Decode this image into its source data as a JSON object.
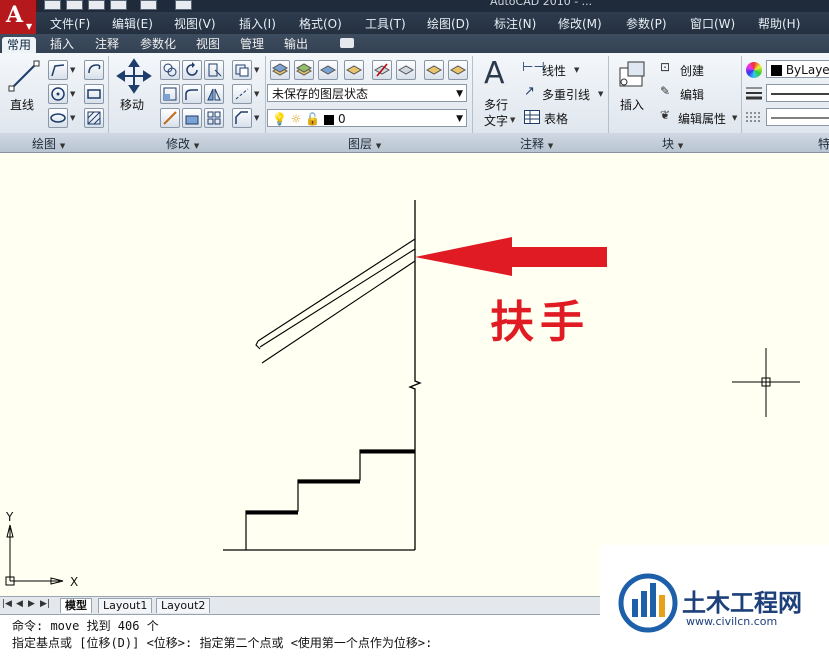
{
  "app": {
    "title_fragment": "AutoCAD 2010 - ..."
  },
  "menubar": [
    "文件(F)",
    "编辑(E)",
    "视图(V)",
    "插入(I)",
    "格式(O)",
    "工具(T)",
    "绘图(D)",
    "标注(N)",
    "修改(M)",
    "参数(P)",
    "窗口(W)",
    "帮助(H)"
  ],
  "tabs": [
    "常用",
    "插入",
    "注释",
    "参数化",
    "视图",
    "管理",
    "输出"
  ],
  "ribbon": {
    "draw": {
      "line": "直线",
      "panel": "绘图"
    },
    "modify": {
      "move": "移动",
      "panel": "修改"
    },
    "layers": {
      "state": "未保存的图层状态",
      "current": "0",
      "panel": "图层"
    },
    "annotation": {
      "mtext_line1": "多行",
      "mtext_line2": "文字",
      "linear": "线性",
      "mleader": "多重引线",
      "table": "表格",
      "panel": "注释"
    },
    "block": {
      "insert": "插入",
      "create": "创建",
      "edit": "编辑",
      "edit_attr": "编辑属性",
      "panel": "块"
    },
    "properties": {
      "color": "ByLayer",
      "panel": "特"
    }
  },
  "drawing": {
    "annotation": "扶手",
    "ucs_x": "X",
    "ucs_y": "Y",
    "arrow_color": "#e01b24"
  },
  "layout_tabs": [
    "模型",
    "Layout1",
    "Layout2"
  ],
  "command": {
    "line1": "命令:  move 找到 406 个",
    "line2": "指定基点或 [位移(D)] <位移>:  指定第二个点或 <使用第一个点作为位移>:"
  },
  "watermark": {
    "name": "土木工程网",
    "url": "www.civilcn.com"
  }
}
